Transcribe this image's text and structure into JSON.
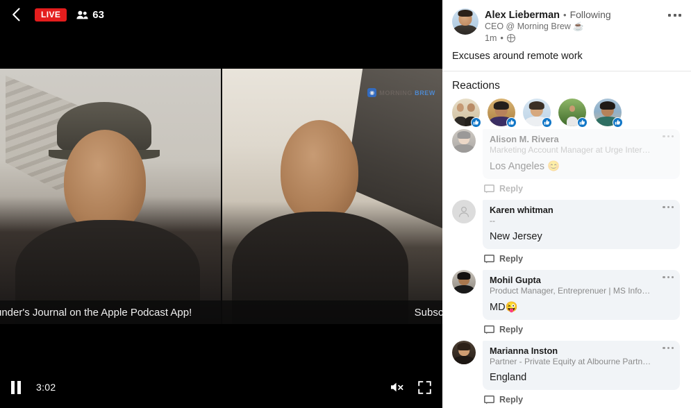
{
  "video": {
    "back_icon": "chevron-left-icon",
    "live_label": "LIVE",
    "viewers_icon": "people-icon",
    "viewer_count": "63",
    "watermark": {
      "mark": "◉",
      "text_main": "MORNING ",
      "text_accent": "BREW"
    },
    "ticker_left": "under's Journal on the Apple Podcast App!",
    "ticker_right": "Subscrib",
    "controls": {
      "pause_icon": "pause-icon",
      "elapsed_time": "3:02",
      "mute_icon": "volume-muted-icon",
      "fullscreen_icon": "fullscreen-icon"
    }
  },
  "post": {
    "author_name": "Alex Lieberman",
    "separator": "•",
    "following_label": "Following",
    "headline": "CEO @ Morning Brew ☕",
    "time_ago": "1m",
    "visibility_icon": "globe-icon",
    "more_icon": "more-options-icon",
    "text": "Excuses around remote work"
  },
  "reactions": {
    "title": "Reactions",
    "badge_icon": "like-thumbs-up-icon",
    "items": [
      {
        "name": "reaction-avatar-1",
        "reaction": "like"
      },
      {
        "name": "reaction-avatar-2",
        "reaction": "like"
      },
      {
        "name": "reaction-avatar-3",
        "reaction": "like"
      },
      {
        "name": "reaction-avatar-4",
        "reaction": "like"
      },
      {
        "name": "reaction-avatar-5",
        "reaction": "like"
      }
    ]
  },
  "comments": {
    "reply_label": "Reply",
    "reply_icon": "comment-bubble-icon",
    "more_icon": "more-options-icon",
    "items": [
      {
        "name": "Alison M. Rivera",
        "headline": "Marketing Account Manager at Urge Inter…",
        "text": "Los Angeles 😊"
      },
      {
        "name": "Karen whitman",
        "headline": "--",
        "text": "New Jersey"
      },
      {
        "name": "Mohil Gupta",
        "headline": "Product Manager, Entreprenuer | MS Info…",
        "text": "MD😜"
      },
      {
        "name": "Marianna Inston",
        "headline": "Partner - Private Equity at Albourne Partn…",
        "text": "England"
      }
    ]
  },
  "colors": {
    "live_red": "#e41d1d",
    "like_blue": "#1277c7",
    "bubble_gray": "#f1f4f7",
    "panel_white": "#ffffff"
  }
}
